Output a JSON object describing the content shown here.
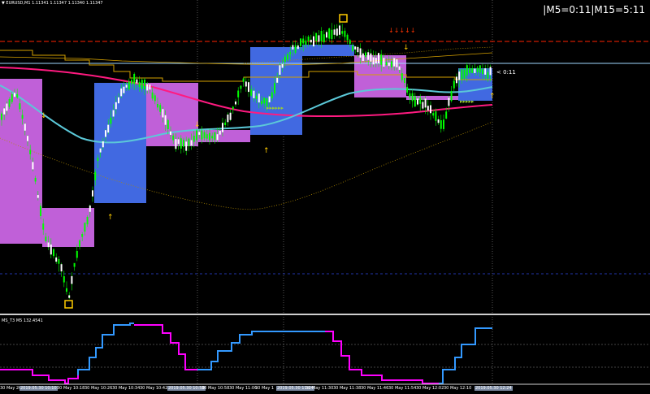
{
  "window": {
    "symbol_label": "▼ EURUSD,M1  1.11341 1.11347 1.11340 1.11347",
    "timer_text": "|M5=0:11|M15=5:11",
    "subwindow_label": "MS_T3 M5 132.4541",
    "price_tag": "< 0:11"
  },
  "colors": {
    "background": "#000000",
    "candle": "#00ff00",
    "box_blue": "#4169e1",
    "box_magenta": "#c060d8",
    "ma_cyan": "#5bc8d8",
    "ma_pink": "#ff1a80",
    "gold": "#d4a000",
    "arrow_yellow": "#ffcc00",
    "arrow_red": "#ff3300",
    "grid": "#9a9a9a",
    "step_blue": "#3399ff",
    "step_magenta": "#ff00ff"
  },
  "time_axis": [
    {
      "label": "30 May 2019",
      "highlight": false
    },
    {
      "label": "2019.05.30 10:10",
      "highlight": true
    },
    {
      "label": "30 May 10:18",
      "highlight": false
    },
    {
      "label": "30 May 10:26",
      "highlight": false
    },
    {
      "label": "30 May 10:34",
      "highlight": false
    },
    {
      "label": "30 May 10:42",
      "highlight": false
    },
    {
      "label": "2019.05.30 10:50",
      "highlight": true
    },
    {
      "label": "30 May 10:58",
      "highlight": false
    },
    {
      "label": "30 May 11:06",
      "highlight": false
    },
    {
      "label": "30 May 1",
      "highlight": false
    },
    {
      "label": "2019.05.30 11:24",
      "highlight": true
    },
    {
      "label": "30 May 11:30",
      "highlight": false
    },
    {
      "label": "30 May 11:38",
      "highlight": false
    },
    {
      "label": "30 May 11:46",
      "highlight": false
    },
    {
      "label": "30 May 11:54",
      "highlight": false
    },
    {
      "label": "30 May 12:02",
      "highlight": false
    },
    {
      "label": "30 May 12:10",
      "highlight": false
    },
    {
      "label": "2019.05.30 12:24",
      "highlight": true
    }
  ]
}
